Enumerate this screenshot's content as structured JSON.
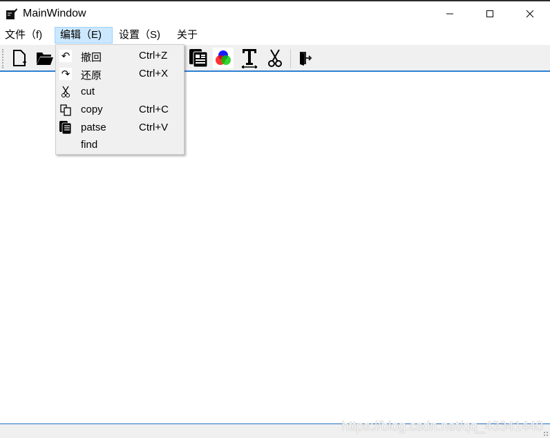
{
  "window": {
    "title": "MainWindow",
    "minimize_icon": "minimize-icon",
    "maximize_icon": "maximize-icon",
    "close_icon": "close-icon"
  },
  "menubar": [
    {
      "label": "文件（f)"
    },
    {
      "label": "编辑（E)"
    },
    {
      "label": "设置（S)"
    },
    {
      "label": "关于"
    }
  ],
  "edit_menu": [
    {
      "label": "撤回",
      "shortcut": "Ctrl+Z",
      "icon": "undo-icon"
    },
    {
      "label": "还原",
      "shortcut": "Ctrl+X",
      "icon": "redo-icon"
    },
    {
      "label": "cut",
      "shortcut": "",
      "icon": "scissors-icon"
    },
    {
      "label": "copy",
      "shortcut": "Ctrl+C",
      "icon": "copy-icon"
    },
    {
      "label": "patse",
      "shortcut": "Ctrl+V",
      "icon": "paste-icon"
    },
    {
      "label": "find",
      "shortcut": "",
      "icon": ""
    }
  ],
  "toolbar": [
    "new-file-icon",
    "open-folder-icon",
    "paste-icon",
    "color-icon",
    "font-icon",
    "cut-icon",
    "exit-icon"
  ],
  "status": {
    "watermark": "https://blog.csdn.net/qq_43341440"
  }
}
